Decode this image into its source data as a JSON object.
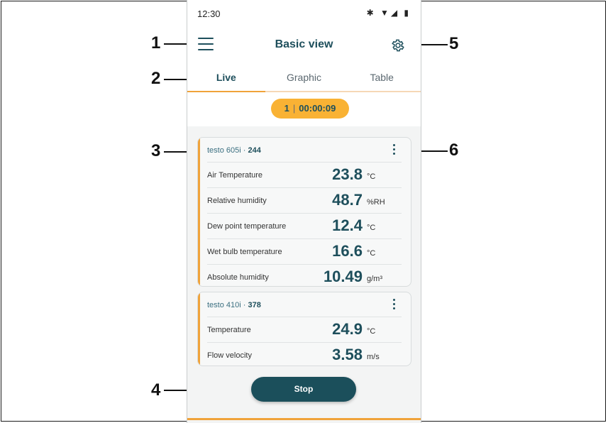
{
  "statusbar": {
    "time": "12:30",
    "icons": "✱ ▼◢ ▮"
  },
  "appbar": {
    "title": "Basic view"
  },
  "tabs": [
    {
      "label": "Live",
      "active": true
    },
    {
      "label": "Graphic",
      "active": false
    },
    {
      "label": "Table",
      "active": false
    }
  ],
  "counter": {
    "count": "1",
    "separator": "|",
    "elapsed": "00:00:09"
  },
  "cards": [
    {
      "device": "testo 605i",
      "serial": "244",
      "rows": [
        {
          "label": "Air Temperature",
          "value": "23.8",
          "unit": "°C"
        },
        {
          "label": "Relative humidity",
          "value": "48.7",
          "unit": "%RH"
        },
        {
          "label": "Dew point temperature",
          "value": "12.4",
          "unit": "°C"
        },
        {
          "label": "Wet bulb temperature",
          "value": "16.6",
          "unit": "°C"
        },
        {
          "label": "Absolute humidity",
          "value": "10.49",
          "unit": "g/m³"
        }
      ]
    },
    {
      "device": "testo 410i",
      "serial": "378",
      "rows": [
        {
          "label": "Temperature",
          "value": "24.9",
          "unit": "°C"
        },
        {
          "label": "Flow velocity",
          "value": "3.58",
          "unit": "m/s"
        }
      ]
    }
  ],
  "stop_button": {
    "label": "Stop"
  },
  "callouts": {
    "c1": "1",
    "c2": "2",
    "c3": "3",
    "c4": "4",
    "c5": "5",
    "c6": "6"
  },
  "colors": {
    "primary": "#1e4f5c",
    "accent": "#f0a33a",
    "pill": "#f9b234"
  }
}
